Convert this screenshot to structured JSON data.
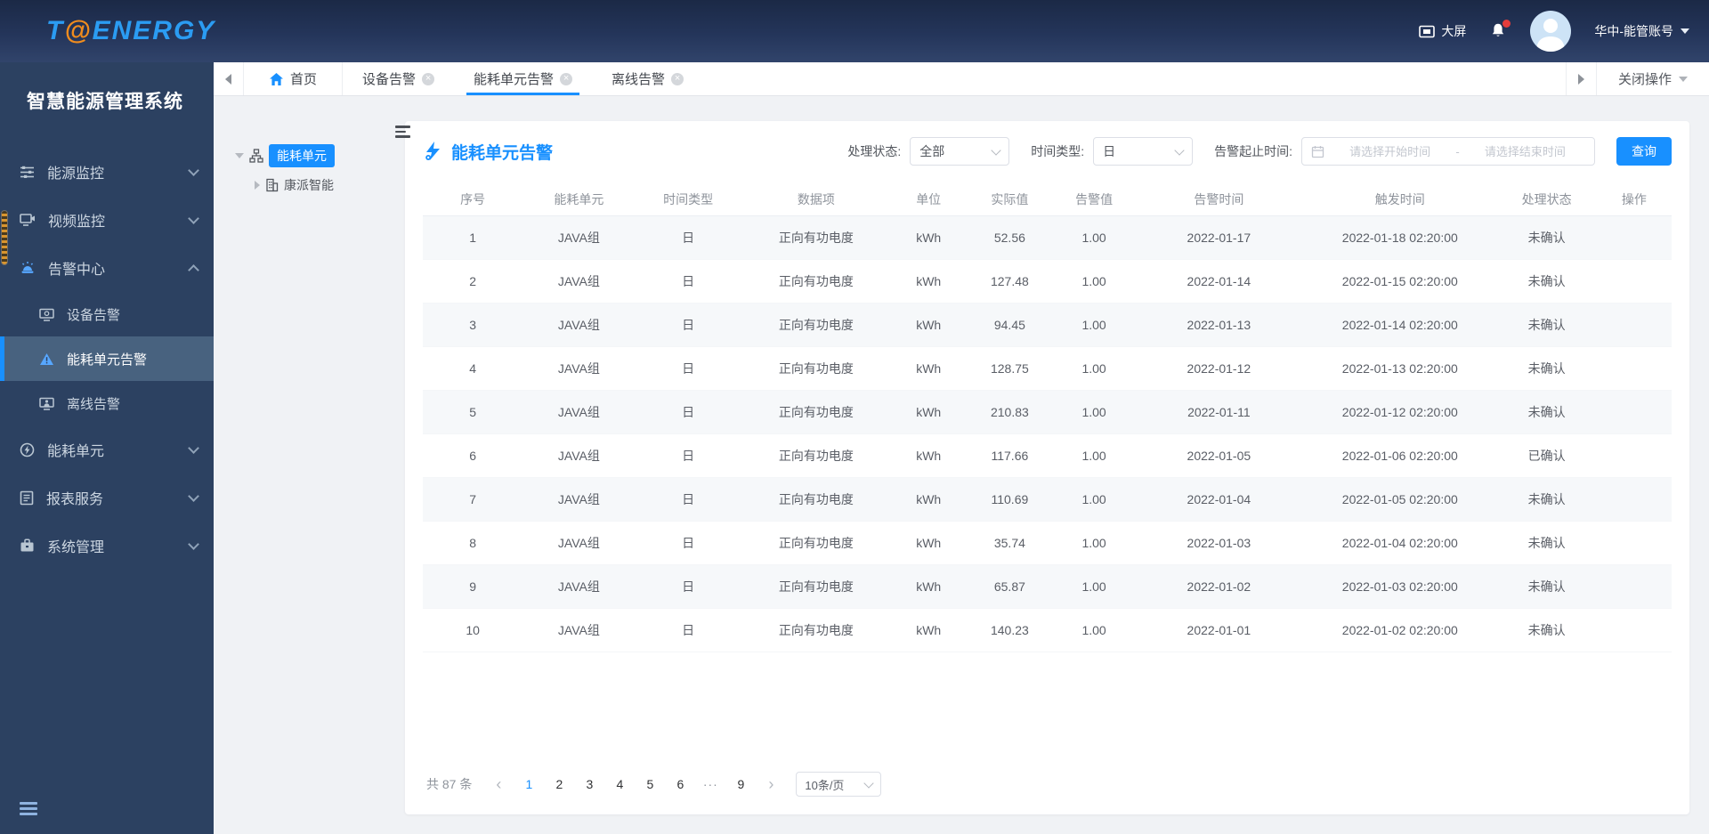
{
  "header": {
    "logo_t": "T",
    "logo_at": "@",
    "logo_rest": "ENERGY",
    "big_screen_label": "大屏",
    "account_name": "华中-能管账号"
  },
  "sidebar": {
    "title": "智慧能源管理系统",
    "items": [
      {
        "label": "能源监控"
      },
      {
        "label": "视频监控"
      },
      {
        "label": "告警中心"
      },
      {
        "label": "能耗单元"
      },
      {
        "label": "报表服务"
      },
      {
        "label": "系统管理"
      }
    ],
    "alarm_children": [
      {
        "label": "设备告警"
      },
      {
        "label": "能耗单元告警"
      },
      {
        "label": "离线告警"
      }
    ]
  },
  "tabs": {
    "items": [
      {
        "label": "首页"
      },
      {
        "label": "设备告警"
      },
      {
        "label": "能耗单元告警"
      },
      {
        "label": "离线告警"
      }
    ],
    "close_ops_label": "关闭操作"
  },
  "tree": {
    "root_label": "能耗单元",
    "child_label": "康派智能"
  },
  "main": {
    "title": "能耗单元告警",
    "filters": {
      "status_label": "处理状态:",
      "status_value": "全部",
      "time_type_label": "时间类型:",
      "time_type_value": "日",
      "range_label": "告警起止时间:",
      "start_placeholder": "请选择开始时间",
      "separator": "-",
      "end_placeholder": "请选择结束时间",
      "search_label": "查询"
    },
    "table": {
      "columns": [
        "序号",
        "能耗单元",
        "时间类型",
        "数据项",
        "单位",
        "实际值",
        "告警值",
        "告警时间",
        "触发时间",
        "处理状态",
        "操作"
      ],
      "rows": [
        [
          "1",
          "JAVA组",
          "日",
          "正向有功电度",
          "kWh",
          "52.56",
          "1.00",
          "2022-01-17",
          "2022-01-18 02:20:00",
          "未确认",
          ""
        ],
        [
          "2",
          "JAVA组",
          "日",
          "正向有功电度",
          "kWh",
          "127.48",
          "1.00",
          "2022-01-14",
          "2022-01-15 02:20:00",
          "未确认",
          ""
        ],
        [
          "3",
          "JAVA组",
          "日",
          "正向有功电度",
          "kWh",
          "94.45",
          "1.00",
          "2022-01-13",
          "2022-01-14 02:20:00",
          "未确认",
          ""
        ],
        [
          "4",
          "JAVA组",
          "日",
          "正向有功电度",
          "kWh",
          "128.75",
          "1.00",
          "2022-01-12",
          "2022-01-13 02:20:00",
          "未确认",
          ""
        ],
        [
          "5",
          "JAVA组",
          "日",
          "正向有功电度",
          "kWh",
          "210.83",
          "1.00",
          "2022-01-11",
          "2022-01-12 02:20:00",
          "未确认",
          ""
        ],
        [
          "6",
          "JAVA组",
          "日",
          "正向有功电度",
          "kWh",
          "117.66",
          "1.00",
          "2022-01-05",
          "2022-01-06 02:20:00",
          "已确认",
          ""
        ],
        [
          "7",
          "JAVA组",
          "日",
          "正向有功电度",
          "kWh",
          "110.69",
          "1.00",
          "2022-01-04",
          "2022-01-05 02:20:00",
          "未确认",
          ""
        ],
        [
          "8",
          "JAVA组",
          "日",
          "正向有功电度",
          "kWh",
          "35.74",
          "1.00",
          "2022-01-03",
          "2022-01-04 02:20:00",
          "未确认",
          ""
        ],
        [
          "9",
          "JAVA组",
          "日",
          "正向有功电度",
          "kWh",
          "65.87",
          "1.00",
          "2022-01-02",
          "2022-01-03 02:20:00",
          "未确认",
          ""
        ],
        [
          "10",
          "JAVA组",
          "日",
          "正向有功电度",
          "kWh",
          "140.23",
          "1.00",
          "2022-01-01",
          "2022-01-02 02:20:00",
          "未确认",
          ""
        ]
      ]
    },
    "pagination": {
      "total": "共 87 条",
      "prev": "‹",
      "next": "›",
      "pages": [
        "1",
        "2",
        "3",
        "4",
        "5",
        "6",
        "···",
        "9"
      ],
      "page_size": "10条/页"
    }
  }
}
